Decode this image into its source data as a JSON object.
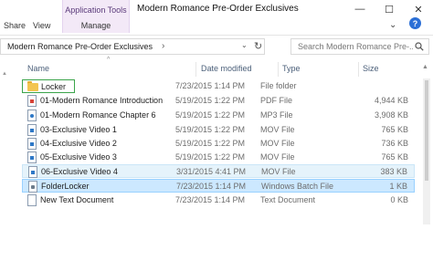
{
  "window": {
    "title": "Modern Romance Pre-Order Exclusives",
    "minimize": "—",
    "maximize": "☐",
    "close": "✕"
  },
  "ribbon": {
    "tabs": [
      "Share",
      "View"
    ],
    "context_group": "Application Tools",
    "context_tab": "Manage",
    "expand": "⌄",
    "help": "?"
  },
  "address": {
    "path": "Modern Romance Pre-Order Exclusives",
    "separator": "›",
    "dropdown": "⌄",
    "refresh": "↻"
  },
  "search": {
    "placeholder": "Search Modern Romance Pre-..."
  },
  "columns": {
    "name": "Name",
    "date": "Date modified",
    "type": "Type",
    "size": "Size"
  },
  "files": [
    {
      "name": "Locker",
      "date": "7/23/2015 1:14 PM",
      "type": "File folder",
      "size": "",
      "icon": "folder-icon"
    },
    {
      "name": "01-Modern Romance Introduction",
      "date": "5/19/2015 1:22 PM",
      "type": "PDF File",
      "size": "4,944 KB",
      "icon": "pdf-file-icon"
    },
    {
      "name": "01-Modern Romance Chapter 6",
      "date": "5/19/2015 1:22 PM",
      "type": "MP3 File",
      "size": "3,908 KB",
      "icon": "mp3-file-icon"
    },
    {
      "name": "03-Exclusive Video 1",
      "date": "5/19/2015 1:22 PM",
      "type": "MOV File",
      "size": "765 KB",
      "icon": "mov-file-icon"
    },
    {
      "name": "04-Exclusive Video 2",
      "date": "5/19/2015 1:22 PM",
      "type": "MOV File",
      "size": "736 KB",
      "icon": "mov-file-icon"
    },
    {
      "name": "05-Exclusive Video 3",
      "date": "5/19/2015 1:22 PM",
      "type": "MOV File",
      "size": "765 KB",
      "icon": "mov-file-icon"
    },
    {
      "name": "06-Exclusive Video 4",
      "date": "3/31/2015 4:41 PM",
      "type": "MOV File",
      "size": "383 KB",
      "icon": "mov-file-icon"
    },
    {
      "name": "FolderLocker",
      "date": "7/23/2015 1:14 PM",
      "type": "Windows Batch File",
      "size": "1 KB",
      "icon": "batch-file-icon"
    },
    {
      "name": "New Text Document",
      "date": "7/23/2015 1:14 PM",
      "type": "Text Document",
      "size": "0 KB",
      "icon": "text-file-icon"
    }
  ],
  "colors": {
    "hover_row": "#e5f3fb",
    "selected_row": "#cce8ff",
    "highlight_outline": "#3aa44a",
    "context_tab": "#f3e9f7"
  }
}
